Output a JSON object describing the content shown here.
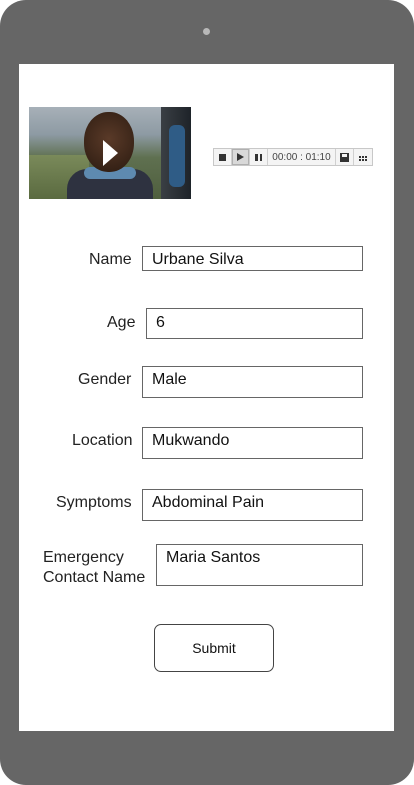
{
  "media_player": {
    "time_display": "00:00 : 01:10",
    "icons": [
      "stop-icon",
      "play-icon",
      "pause-icon",
      "save-icon",
      "menu-icon"
    ]
  },
  "form": {
    "name": {
      "label": "Name",
      "value": "Urbane Silva"
    },
    "age": {
      "label": "Age",
      "value": "6"
    },
    "gender": {
      "label": "Gender",
      "value": "Male"
    },
    "location": {
      "label": "Location",
      "value": "Mukwando"
    },
    "symptoms": {
      "label": "Symptoms",
      "value": "Abdominal Pain"
    },
    "emergency_contact": {
      "label_line1": "Emergency",
      "label_line2": "Contact Name",
      "value": "Maria Santos"
    },
    "submit_label": "Submit"
  },
  "colors": {
    "device_frame": "#666666",
    "screen": "#ffffff",
    "field_border": "#666666"
  }
}
